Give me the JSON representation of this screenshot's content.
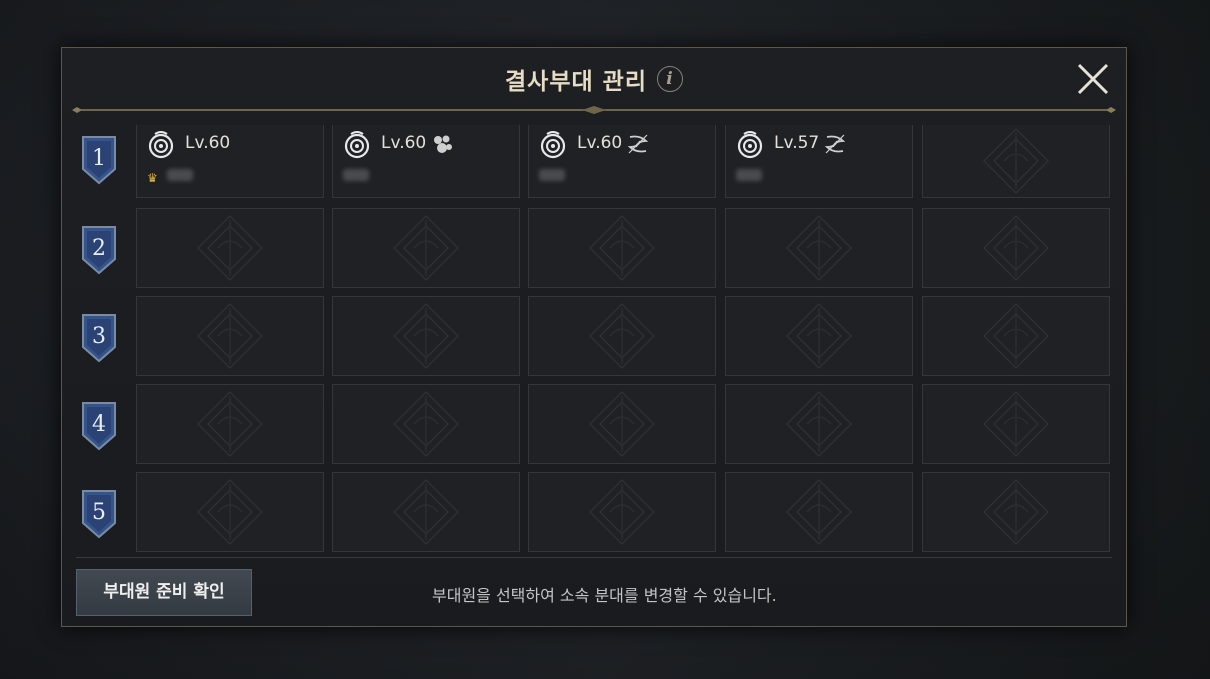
{
  "dialog": {
    "title": "결사부대 관리",
    "info_icon": "i",
    "close_icon": "close-icon",
    "squads": [
      {
        "label": "1",
        "slots": [
          {
            "level": "Lv.60",
            "role_icon": null,
            "leader": true
          },
          {
            "level": "Lv.60",
            "role_icon": "paw-group-icon",
            "leader": false
          },
          {
            "level": "Lv.60",
            "role_icon": "swirl-icon",
            "leader": false
          },
          {
            "level": "Lv.57",
            "role_icon": "swirl-icon",
            "leader": false
          },
          null
        ]
      },
      {
        "label": "2",
        "slots": [
          null,
          null,
          null,
          null,
          null
        ]
      },
      {
        "label": "3",
        "slots": [
          null,
          null,
          null,
          null,
          null
        ]
      },
      {
        "label": "4",
        "slots": [
          null,
          null,
          null,
          null,
          null
        ]
      },
      {
        "label": "5",
        "slots": [
          null,
          null,
          null,
          null,
          null
        ]
      }
    ],
    "footer": {
      "ready_check_label": "부대원 준비 확인",
      "hint": "부대원을 선택하여 소속 분대를 변경할 수 있습니다."
    }
  },
  "colors": {
    "title": "#e8dcc4",
    "frame_gold": "#8a7d5a",
    "badge_blue": "#3a5a8c",
    "slot_border": "#34363b"
  }
}
